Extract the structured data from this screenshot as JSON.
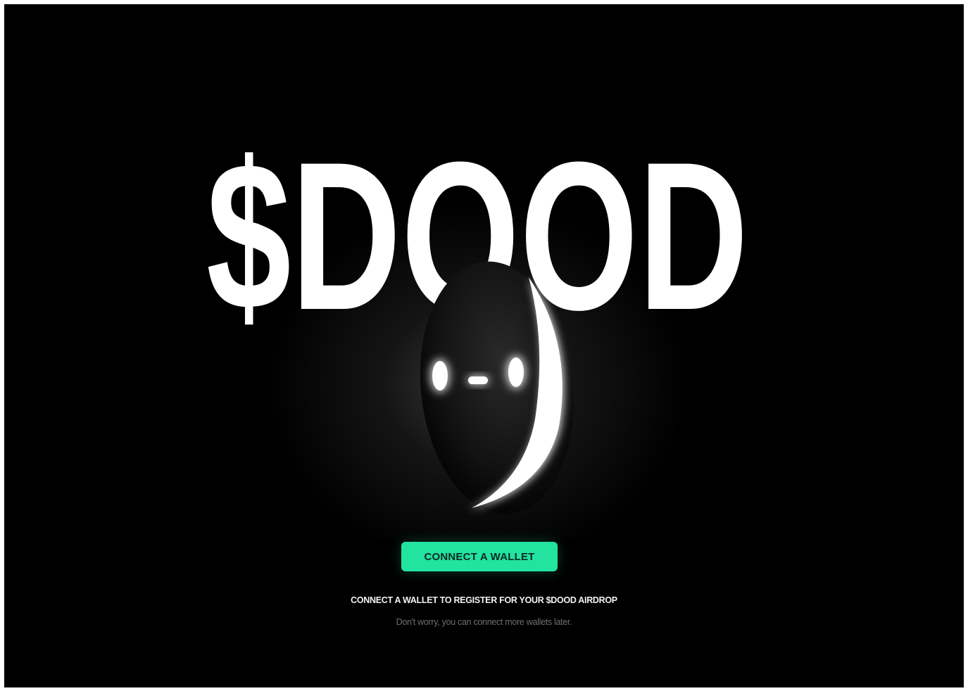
{
  "logo": {
    "text": "$DOOD"
  },
  "connect_button": {
    "label": "CONNECT A WALLET"
  },
  "register_text": "CONNECT A WALLET TO REGISTER FOR YOUR $DOOD AIRDROP",
  "subtext": "Don't worry, you can connect more wallets later.",
  "colors": {
    "background": "#000000",
    "accent": "#22e3a0",
    "logo": "#ffffff"
  }
}
